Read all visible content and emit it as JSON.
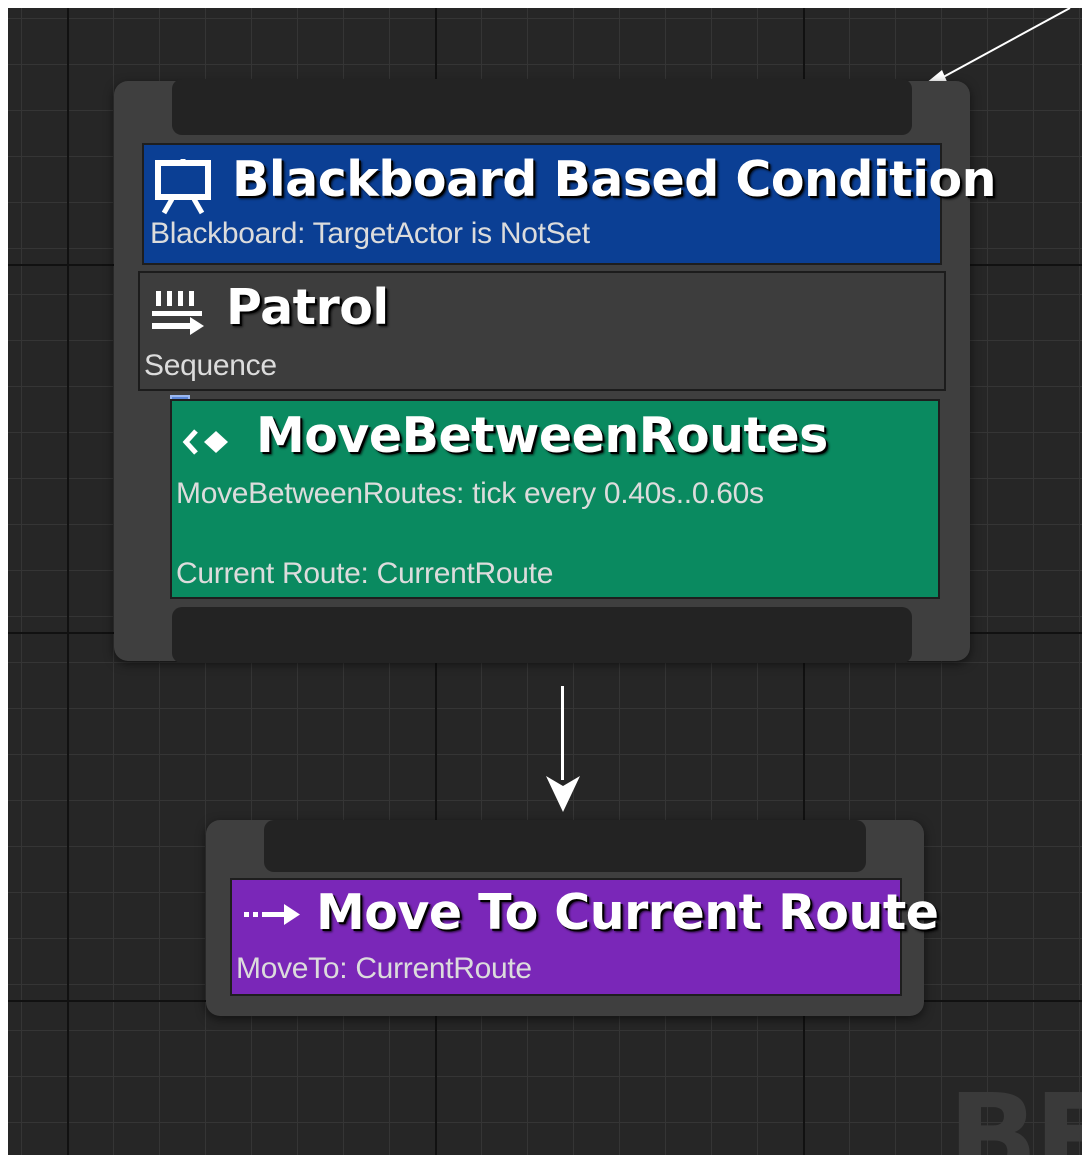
{
  "decorator": {
    "title": "Blackboard Based Condition",
    "subtitle": "Blackboard: TargetActor is NotSet",
    "icon": "blackboard-icon",
    "color": "#0b3f94"
  },
  "composite": {
    "title": "Patrol",
    "subtitle": "Sequence",
    "icon": "sequence-icon",
    "color": "#3d3d3d"
  },
  "service": {
    "title": "MoveBetweenRoutes",
    "subtitle": "MoveBetweenRoutes: tick every 0.40s..0.60s",
    "detail": "Current Route: CurrentRoute",
    "icon": "service-icon",
    "color": "#0a8a60"
  },
  "task": {
    "title": "Move To Current Route",
    "subtitle": "MoveTo: CurrentRoute",
    "icon": "move-to-icon",
    "color": "#7a27b8"
  },
  "watermark": "BE"
}
